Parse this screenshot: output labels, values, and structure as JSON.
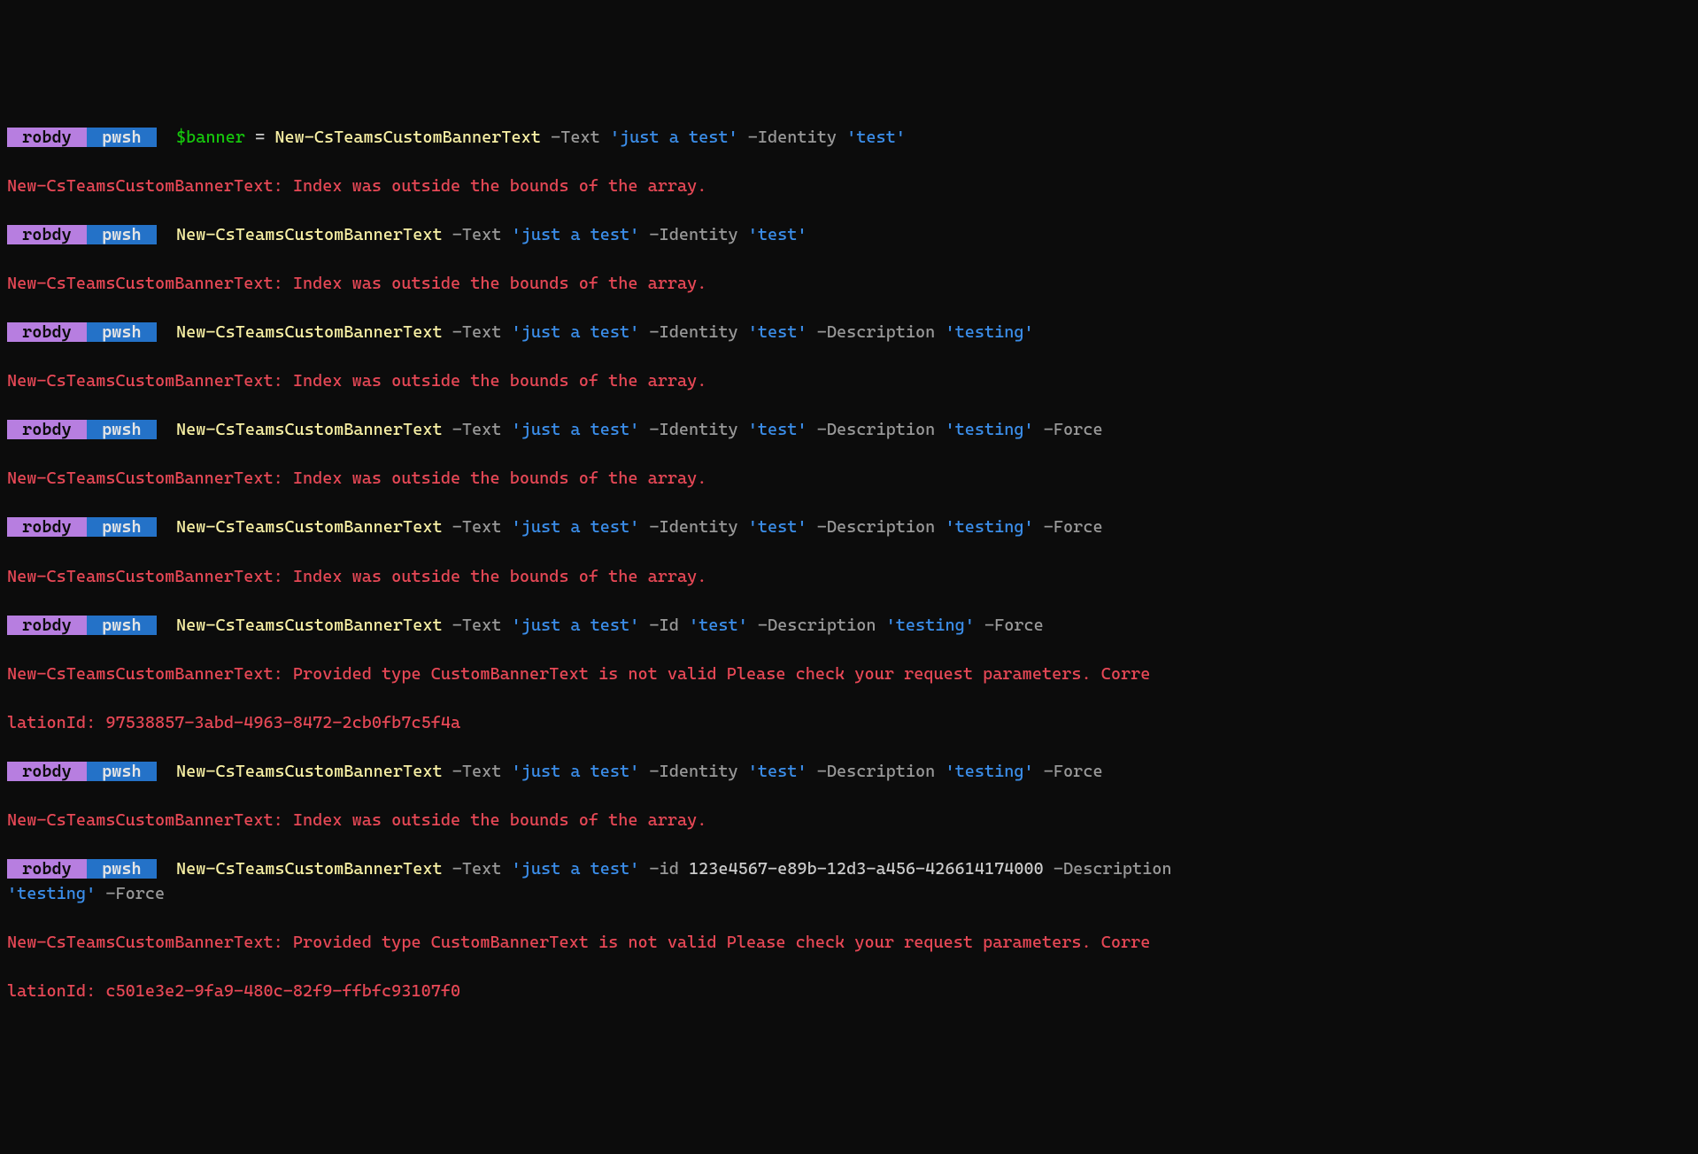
{
  "prompt": {
    "user": " robdy ",
    "shell": " pwsh "
  },
  "cmd": "New-CsTeamsCustomBannerText",
  "var": "$banner",
  "eq": " = ",
  "params": {
    "text": "-Text",
    "identity": "-Identity",
    "id": "-Id",
    "id_lc": "-id",
    "description": "-Description",
    "force": "-Force"
  },
  "strings": {
    "just_a_test": "'just a test'",
    "test": "'test'",
    "testing": "'testing'"
  },
  "guid": "123e4567-e89b-12d3-a456-426614174000",
  "errors": {
    "index": "New-CsTeamsCustomBannerText: Index was outside the bounds of the array.",
    "invalid1_a": "New-CsTeamsCustomBannerText: Provided type CustomBannerText is not valid Please check your request parameters. Corre",
    "invalid1_b": "lationId: 97538857-3abd-4963-8472-2cb0fb7c5f4a",
    "invalid2_a": "New-CsTeamsCustomBannerText: Provided type CustomBannerText is not valid Please check your request parameters. Corre",
    "invalid2_b": "lationId: c501e3e2-9fa9-480c-82f9-ffbfc93107f0"
  }
}
